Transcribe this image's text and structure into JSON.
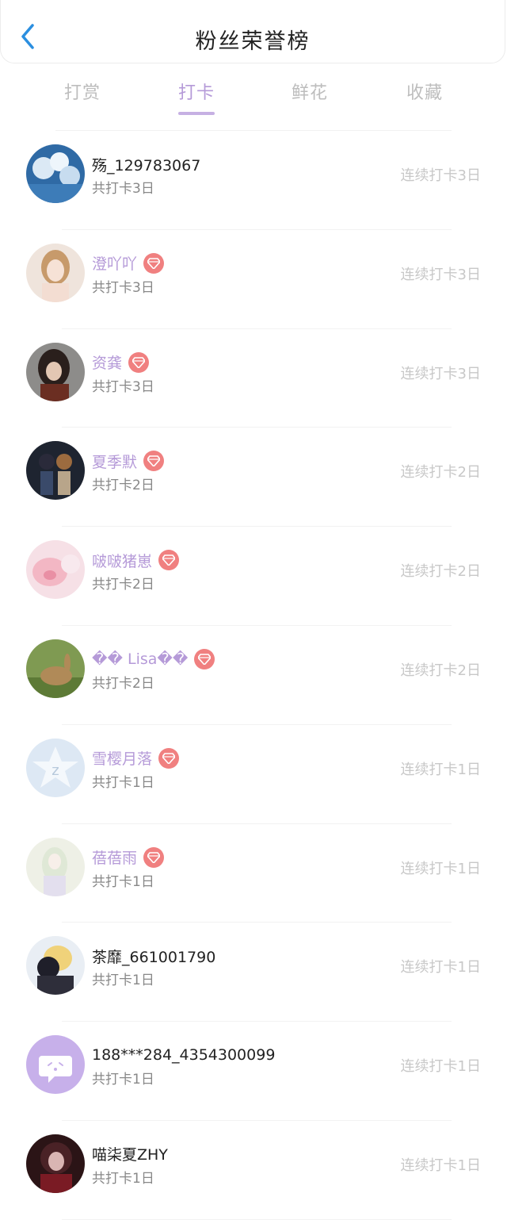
{
  "header": {
    "title": "粉丝荣誉榜",
    "back_icon": "chevron-left-icon"
  },
  "tabs": [
    {
      "label": "打赏",
      "active": false
    },
    {
      "label": "打卡",
      "active": true
    },
    {
      "label": "鲜花",
      "active": false
    },
    {
      "label": "收藏",
      "active": false
    }
  ],
  "colors": {
    "accent": "#b59ad8",
    "badge": "#f08080",
    "back": "#2b8fe0"
  },
  "fans": [
    {
      "name": "殇_129783067",
      "vip": false,
      "total": "共打卡3日",
      "streak": "连续打卡3日"
    },
    {
      "name": "澄吖吖",
      "vip": true,
      "total": "共打卡3日",
      "streak": "连续打卡3日"
    },
    {
      "name": "资龚",
      "vip": true,
      "total": "共打卡3日",
      "streak": "连续打卡3日"
    },
    {
      "name": "夏季默",
      "vip": true,
      "total": "共打卡2日",
      "streak": "连续打卡2日"
    },
    {
      "name": "啵啵猪崽",
      "vip": true,
      "total": "共打卡2日",
      "streak": "连续打卡2日"
    },
    {
      "name": "�� Lisa��",
      "vip": true,
      "total": "共打卡2日",
      "streak": "连续打卡2日"
    },
    {
      "name": "雪樱月落",
      "vip": true,
      "total": "共打卡1日",
      "streak": "连续打卡1日"
    },
    {
      "name": "蓓蓓雨",
      "vip": true,
      "total": "共打卡1日",
      "streak": "连续打卡1日"
    },
    {
      "name": "茶靡_661001790",
      "vip": false,
      "total": "共打卡1日",
      "streak": "连续打卡1日"
    },
    {
      "name": "188***284_4354300099",
      "vip": false,
      "total": "共打卡1日",
      "streak": "连续打卡1日"
    },
    {
      "name": "喵柒夏ZHY",
      "vip": false,
      "total": "共打卡1日",
      "streak": "连续打卡1日"
    }
  ]
}
